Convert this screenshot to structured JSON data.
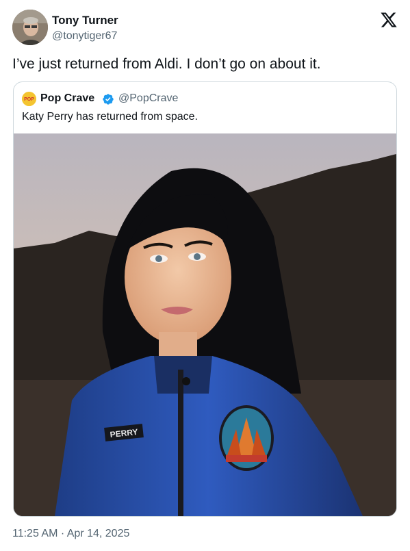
{
  "author": {
    "name": "Tony Turner",
    "handle": "@tonytiger67"
  },
  "tweet": {
    "text": "I’ve just returned from Aldi. I don’t go on about it.",
    "timestamp": "11:25 AM · Apr 14, 2025"
  },
  "quoted_tweet": {
    "name": "Pop Crave",
    "handle": "@PopCrave",
    "text": "Katy Perry has returned from space.",
    "avatar_text": "POP",
    "name_tag": "PERRY"
  },
  "colors": {
    "text_primary": "#0f1419",
    "text_secondary": "#536471",
    "verified": "#1d9bf0",
    "border": "#cfd9de"
  },
  "icons": {
    "logo": "x-logo-icon",
    "verified": "verified-badge-icon"
  }
}
